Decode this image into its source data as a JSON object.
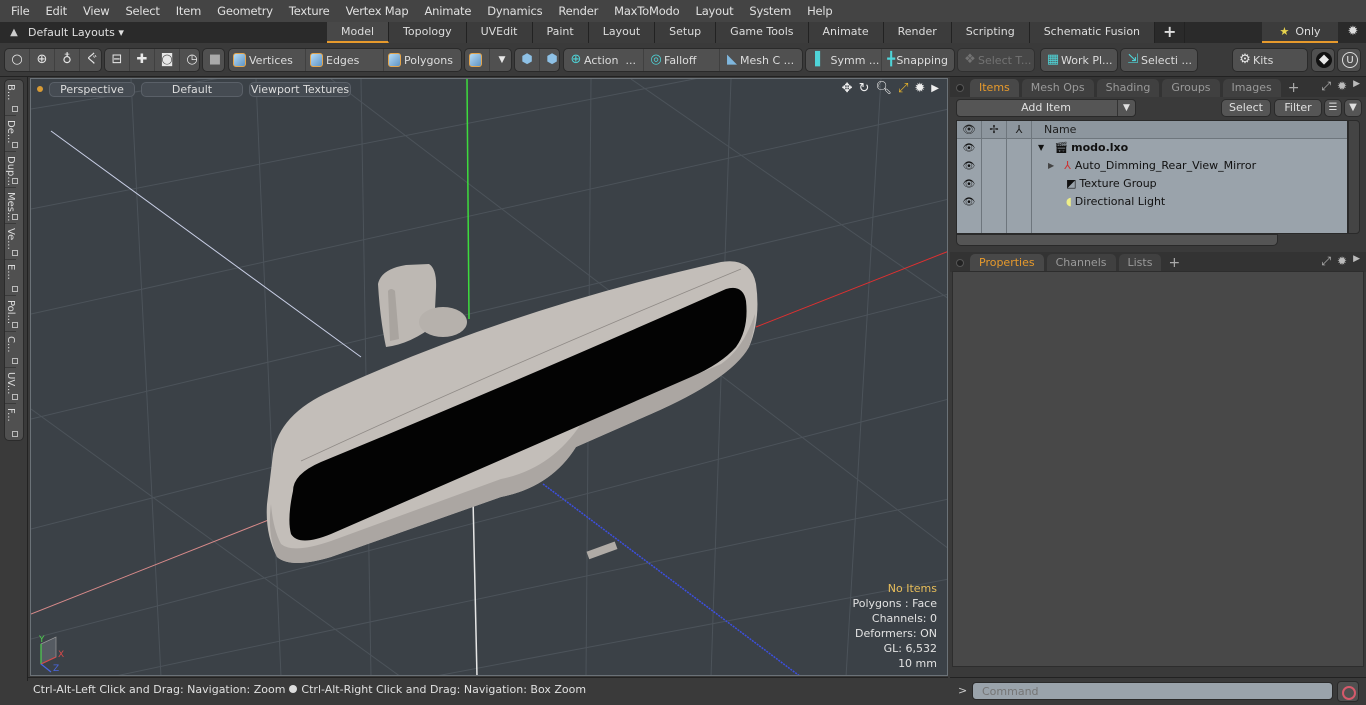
{
  "menu": [
    "File",
    "Edit",
    "View",
    "Select",
    "Item",
    "Geometry",
    "Texture",
    "Vertex Map",
    "Animate",
    "Dynamics",
    "Render",
    "MaxToModo",
    "Layout",
    "System",
    "Help"
  ],
  "layouts_label": "Default Layouts",
  "layout_tabs": [
    {
      "label": "Model",
      "active": true
    },
    {
      "label": "Topology"
    },
    {
      "label": "UVEdit"
    },
    {
      "label": "Paint"
    },
    {
      "label": "Layout"
    },
    {
      "label": "Setup"
    },
    {
      "label": "Game Tools"
    },
    {
      "label": "Animate"
    },
    {
      "label": "Render"
    },
    {
      "label": "Scripting"
    },
    {
      "label": "Schematic Fusion"
    }
  ],
  "only_label": "Only",
  "toolbar": {
    "vertices": "Vertices",
    "edges": "Edges",
    "polygons": "Polygons",
    "action": "Action",
    "falloff": "Falloff",
    "mesh": "Mesh C ...",
    "symm": "Symm ...",
    "snapping": "Snapping",
    "select_t": "Select T...",
    "work_pl": "Work Pl...",
    "selecti": "Selecti ...",
    "kits": "Kits",
    "ellipsis": "..."
  },
  "left_tabs": [
    "B...",
    "De...",
    "Dup...",
    "Mes...",
    "Ve...",
    "E...",
    "Pol...",
    "C...",
    "UV...",
    "F..."
  ],
  "viewport": {
    "view": "Perspective",
    "shading": "Default",
    "textures": "Viewport Textures",
    "info": {
      "selection": "No Items",
      "polygons": "Polygons : Face",
      "channels": "Channels: 0",
      "deformers": "Deformers: ON",
      "gl": "GL: 6,532",
      "scale": "10 mm"
    },
    "axis_labels": {
      "x": "X",
      "y": "Y",
      "z": "Z"
    }
  },
  "status": {
    "left": "Ctrl-Alt-Left Click and Drag: Navigation: Zoom",
    "right": "Ctrl-Alt-Right Click and Drag: Navigation: Box Zoom"
  },
  "items_panel": {
    "tabs": [
      {
        "label": "Items",
        "active": true
      },
      {
        "label": "Mesh Ops"
      },
      {
        "label": "Shading"
      },
      {
        "label": "Groups"
      },
      {
        "label": "Images"
      }
    ],
    "add_item": "Add Item",
    "select": "Select",
    "filter": "Filter",
    "name_header": "Name",
    "tree": [
      {
        "label": "modo.lxo",
        "bold": true,
        "icon": "scene-icon",
        "depth": 0
      },
      {
        "label": "Auto_Dimming_Rear_View_Mirror",
        "icon": "mesh-locator-icon",
        "depth": 1
      },
      {
        "label": "Texture Group",
        "icon": "texture-group-icon",
        "depth": 1
      },
      {
        "label": "Directional Light",
        "icon": "light-icon",
        "depth": 1
      }
    ]
  },
  "props_panel": {
    "tabs": [
      {
        "label": "Properties",
        "active": true
      },
      {
        "label": "Channels"
      },
      {
        "label": "Lists"
      }
    ]
  },
  "command": {
    "placeholder": "Command",
    "prompt": ">"
  }
}
